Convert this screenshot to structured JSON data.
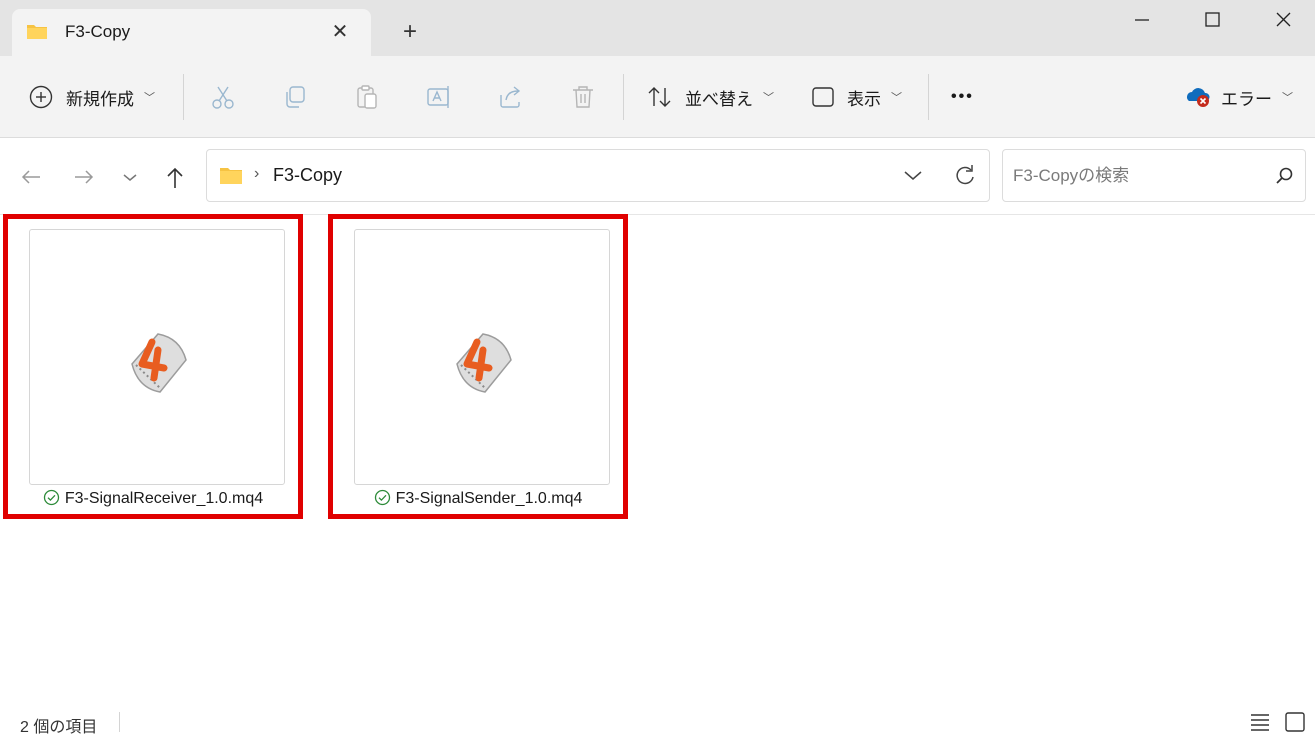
{
  "window": {
    "tab_title": "F3-Copy",
    "new_tab_symbol": "+",
    "close_tab_symbol": "✕"
  },
  "toolbar": {
    "new_label": "新規作成",
    "sort_label": "並べ替え",
    "view_label": "表示",
    "more_label": "•••",
    "account_status_label": "エラー",
    "icons": [
      "plus-circle-icon",
      "cut-icon",
      "copy-icon",
      "paste-icon",
      "rename-icon",
      "share-icon",
      "delete-icon",
      "sort-icon",
      "view-icon",
      "more-icon",
      "onedrive-error-icon"
    ]
  },
  "address": {
    "separator": "›",
    "path": "F3-Copy",
    "search_placeholder": "F3-Copyの検索"
  },
  "files": [
    {
      "name": "F3-SignalReceiver_1.0.mq4",
      "status": "synced"
    },
    {
      "name": "F3-SignalSender_1.0.mq4",
      "status": "synced"
    }
  ],
  "status_bar": {
    "item_count": "2 個の項目"
  },
  "colors": {
    "highlight": "#e00000",
    "titlebar": "#e4e4e4",
    "commandbar": "#f3f3f3",
    "folder": "#f6c343",
    "sync_ok": "#2e8b3a"
  }
}
